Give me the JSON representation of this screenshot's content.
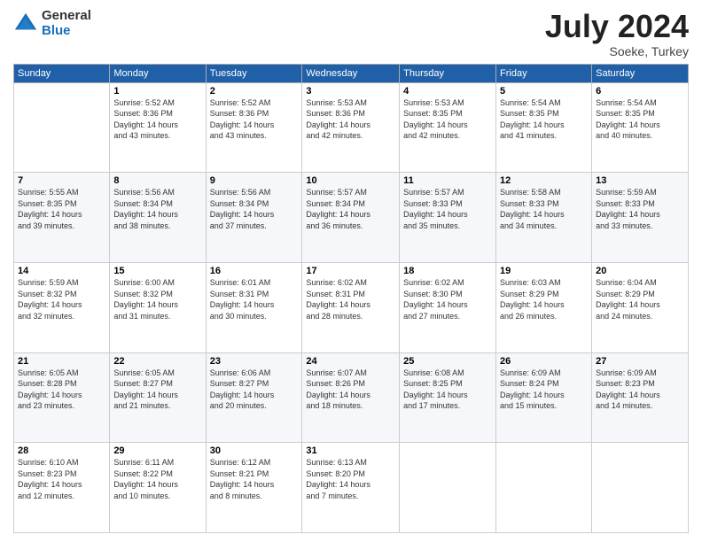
{
  "logo": {
    "general": "General",
    "blue": "Blue"
  },
  "title": {
    "month_year": "July 2024",
    "location": "Soeke, Turkey"
  },
  "days_header": [
    "Sunday",
    "Monday",
    "Tuesday",
    "Wednesday",
    "Thursday",
    "Friday",
    "Saturday"
  ],
  "weeks": [
    [
      {
        "day": "",
        "info": ""
      },
      {
        "day": "1",
        "info": "Sunrise: 5:52 AM\nSunset: 8:36 PM\nDaylight: 14 hours\nand 43 minutes."
      },
      {
        "day": "2",
        "info": "Sunrise: 5:52 AM\nSunset: 8:36 PM\nDaylight: 14 hours\nand 43 minutes."
      },
      {
        "day": "3",
        "info": "Sunrise: 5:53 AM\nSunset: 8:36 PM\nDaylight: 14 hours\nand 42 minutes."
      },
      {
        "day": "4",
        "info": "Sunrise: 5:53 AM\nSunset: 8:35 PM\nDaylight: 14 hours\nand 42 minutes."
      },
      {
        "day": "5",
        "info": "Sunrise: 5:54 AM\nSunset: 8:35 PM\nDaylight: 14 hours\nand 41 minutes."
      },
      {
        "day": "6",
        "info": "Sunrise: 5:54 AM\nSunset: 8:35 PM\nDaylight: 14 hours\nand 40 minutes."
      }
    ],
    [
      {
        "day": "7",
        "info": "Sunrise: 5:55 AM\nSunset: 8:35 PM\nDaylight: 14 hours\nand 39 minutes."
      },
      {
        "day": "8",
        "info": "Sunrise: 5:56 AM\nSunset: 8:34 PM\nDaylight: 14 hours\nand 38 minutes."
      },
      {
        "day": "9",
        "info": "Sunrise: 5:56 AM\nSunset: 8:34 PM\nDaylight: 14 hours\nand 37 minutes."
      },
      {
        "day": "10",
        "info": "Sunrise: 5:57 AM\nSunset: 8:34 PM\nDaylight: 14 hours\nand 36 minutes."
      },
      {
        "day": "11",
        "info": "Sunrise: 5:57 AM\nSunset: 8:33 PM\nDaylight: 14 hours\nand 35 minutes."
      },
      {
        "day": "12",
        "info": "Sunrise: 5:58 AM\nSunset: 8:33 PM\nDaylight: 14 hours\nand 34 minutes."
      },
      {
        "day": "13",
        "info": "Sunrise: 5:59 AM\nSunset: 8:33 PM\nDaylight: 14 hours\nand 33 minutes."
      }
    ],
    [
      {
        "day": "14",
        "info": "Sunrise: 5:59 AM\nSunset: 8:32 PM\nDaylight: 14 hours\nand 32 minutes."
      },
      {
        "day": "15",
        "info": "Sunrise: 6:00 AM\nSunset: 8:32 PM\nDaylight: 14 hours\nand 31 minutes."
      },
      {
        "day": "16",
        "info": "Sunrise: 6:01 AM\nSunset: 8:31 PM\nDaylight: 14 hours\nand 30 minutes."
      },
      {
        "day": "17",
        "info": "Sunrise: 6:02 AM\nSunset: 8:31 PM\nDaylight: 14 hours\nand 28 minutes."
      },
      {
        "day": "18",
        "info": "Sunrise: 6:02 AM\nSunset: 8:30 PM\nDaylight: 14 hours\nand 27 minutes."
      },
      {
        "day": "19",
        "info": "Sunrise: 6:03 AM\nSunset: 8:29 PM\nDaylight: 14 hours\nand 26 minutes."
      },
      {
        "day": "20",
        "info": "Sunrise: 6:04 AM\nSunset: 8:29 PM\nDaylight: 14 hours\nand 24 minutes."
      }
    ],
    [
      {
        "day": "21",
        "info": "Sunrise: 6:05 AM\nSunset: 8:28 PM\nDaylight: 14 hours\nand 23 minutes."
      },
      {
        "day": "22",
        "info": "Sunrise: 6:05 AM\nSunset: 8:27 PM\nDaylight: 14 hours\nand 21 minutes."
      },
      {
        "day": "23",
        "info": "Sunrise: 6:06 AM\nSunset: 8:27 PM\nDaylight: 14 hours\nand 20 minutes."
      },
      {
        "day": "24",
        "info": "Sunrise: 6:07 AM\nSunset: 8:26 PM\nDaylight: 14 hours\nand 18 minutes."
      },
      {
        "day": "25",
        "info": "Sunrise: 6:08 AM\nSunset: 8:25 PM\nDaylight: 14 hours\nand 17 minutes."
      },
      {
        "day": "26",
        "info": "Sunrise: 6:09 AM\nSunset: 8:24 PM\nDaylight: 14 hours\nand 15 minutes."
      },
      {
        "day": "27",
        "info": "Sunrise: 6:09 AM\nSunset: 8:23 PM\nDaylight: 14 hours\nand 14 minutes."
      }
    ],
    [
      {
        "day": "28",
        "info": "Sunrise: 6:10 AM\nSunset: 8:23 PM\nDaylight: 14 hours\nand 12 minutes."
      },
      {
        "day": "29",
        "info": "Sunrise: 6:11 AM\nSunset: 8:22 PM\nDaylight: 14 hours\nand 10 minutes."
      },
      {
        "day": "30",
        "info": "Sunrise: 6:12 AM\nSunset: 8:21 PM\nDaylight: 14 hours\nand 8 minutes."
      },
      {
        "day": "31",
        "info": "Sunrise: 6:13 AM\nSunset: 8:20 PM\nDaylight: 14 hours\nand 7 minutes."
      },
      {
        "day": "",
        "info": ""
      },
      {
        "day": "",
        "info": ""
      },
      {
        "day": "",
        "info": ""
      }
    ]
  ]
}
